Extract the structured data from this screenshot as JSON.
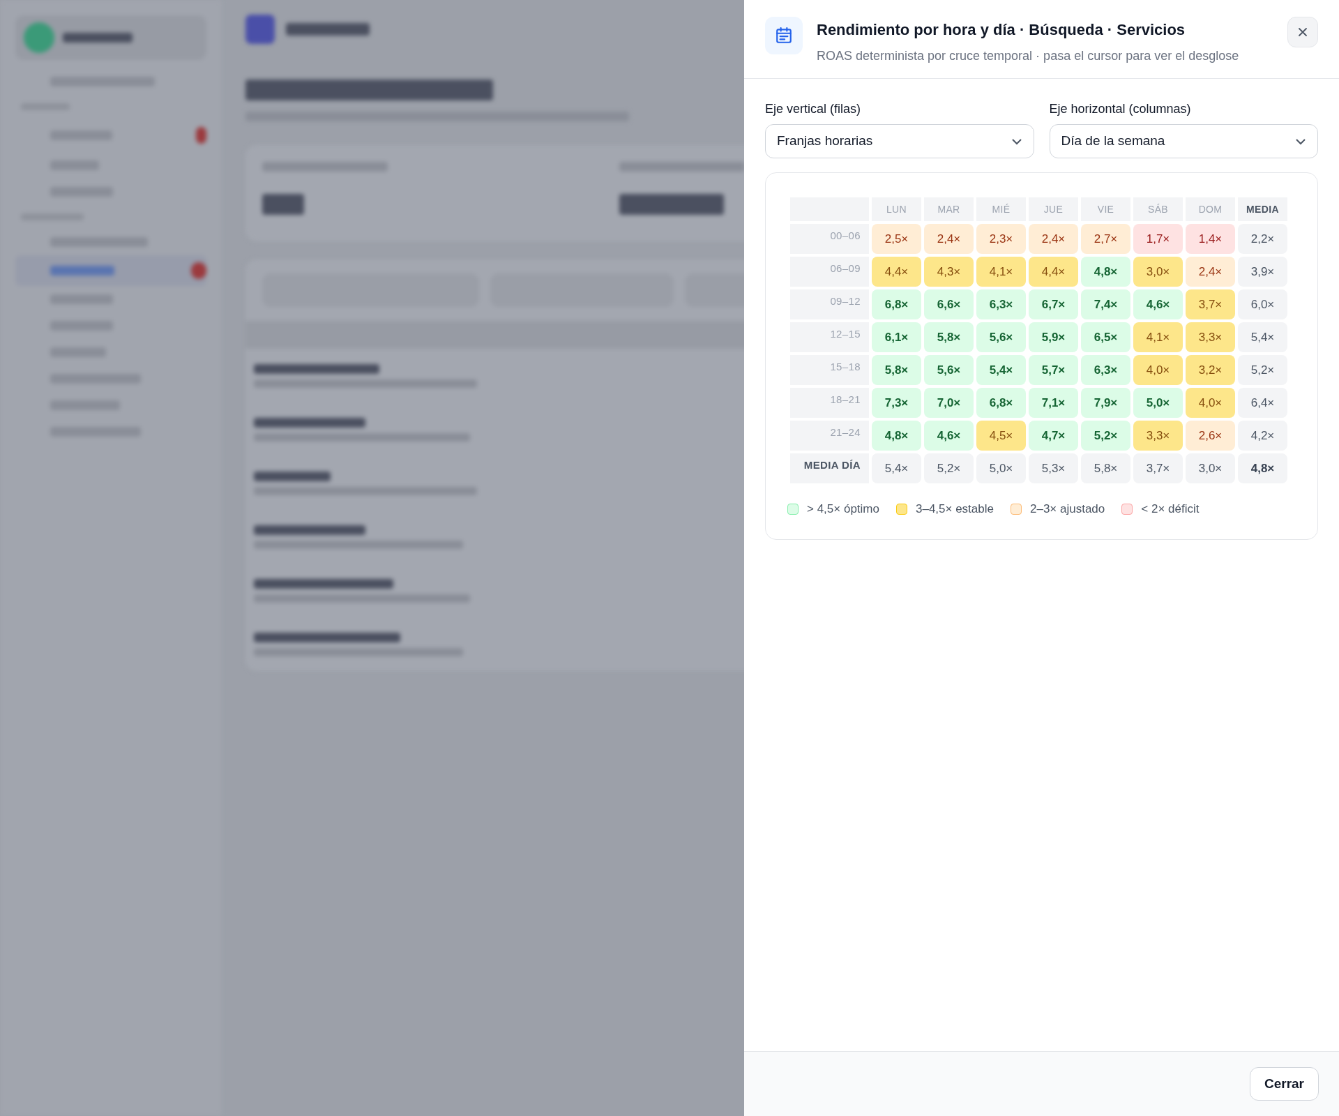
{
  "panel": {
    "title": "Rendimiento por hora y día · Búsqueda · Servicios",
    "subtitle": "ROAS determinista por cruce temporal · pasa el cursor para ver el desglose",
    "selects": [
      {
        "label": "Eje vertical (filas)",
        "value": "Franjas horarias"
      },
      {
        "label": "Eje horizontal (columnas)",
        "value": "Día de la semana"
      }
    ],
    "heatmap": {
      "columns": [
        "LUN",
        "MAR",
        "MIÉ",
        "JUE",
        "VIE",
        "SÁB",
        "DOM"
      ],
      "mean_column": "MEDIA",
      "rows": [
        {
          "label": "00–06",
          "cells": [
            {
              "value": "2,5×",
              "color": "#ffedd5"
            },
            {
              "value": "2,4×",
              "color": "#ffedd5"
            },
            {
              "value": "2,3×",
              "color": "#ffedd5"
            },
            {
              "value": "2,4×",
              "color": "#ffedd5"
            },
            {
              "value": "2,7×",
              "color": "#ffedd5"
            },
            {
              "value": "1,7×",
              "color": "#fee2e2"
            },
            {
              "value": "1,4×",
              "color": "#fee2e2"
            }
          ],
          "mean": "2,2×"
        },
        {
          "label": "06–09",
          "cells": [
            {
              "value": "4,4×",
              "color": "#fde68a"
            },
            {
              "value": "4,3×",
              "color": "#fde68a"
            },
            {
              "value": "4,1×",
              "color": "#fde68a"
            },
            {
              "value": "4,4×",
              "color": "#fde68a"
            },
            {
              "value": "4,8×",
              "color": "#dcfce7"
            },
            {
              "value": "3,0×",
              "color": "#fde68a"
            },
            {
              "value": "2,4×",
              "color": "#ffedd5"
            }
          ],
          "mean": "3,9×"
        },
        {
          "label": "09–12",
          "cells": [
            {
              "value": "6,8×",
              "color": "#dcfce7"
            },
            {
              "value": "6,6×",
              "color": "#dcfce7"
            },
            {
              "value": "6,3×",
              "color": "#dcfce7"
            },
            {
              "value": "6,7×",
              "color": "#dcfce7"
            },
            {
              "value": "7,4×",
              "color": "#dcfce7"
            },
            {
              "value": "4,6×",
              "color": "#dcfce7"
            },
            {
              "value": "3,7×",
              "color": "#fde68a"
            }
          ],
          "mean": "6,0×"
        },
        {
          "label": "12–15",
          "cells": [
            {
              "value": "6,1×",
              "color": "#dcfce7"
            },
            {
              "value": "5,8×",
              "color": "#dcfce7"
            },
            {
              "value": "5,6×",
              "color": "#dcfce7"
            },
            {
              "value": "5,9×",
              "color": "#dcfce7"
            },
            {
              "value": "6,5×",
              "color": "#dcfce7"
            },
            {
              "value": "4,1×",
              "color": "#fde68a"
            },
            {
              "value": "3,3×",
              "color": "#fde68a"
            }
          ],
          "mean": "5,4×"
        },
        {
          "label": "15–18",
          "cells": [
            {
              "value": "5,8×",
              "color": "#dcfce7"
            },
            {
              "value": "5,6×",
              "color": "#dcfce7"
            },
            {
              "value": "5,4×",
              "color": "#dcfce7"
            },
            {
              "value": "5,7×",
              "color": "#dcfce7"
            },
            {
              "value": "6,3×",
              "color": "#dcfce7"
            },
            {
              "value": "4,0×",
              "color": "#fde68a"
            },
            {
              "value": "3,2×",
              "color": "#fde68a"
            }
          ],
          "mean": "5,2×"
        },
        {
          "label": "18–21",
          "cells": [
            {
              "value": "7,3×",
              "color": "#dcfce7"
            },
            {
              "value": "7,0×",
              "color": "#dcfce7"
            },
            {
              "value": "6,8×",
              "color": "#dcfce7"
            },
            {
              "value": "7,1×",
              "color": "#dcfce7"
            },
            {
              "value": "7,9×",
              "color": "#dcfce7"
            },
            {
              "value": "5,0×",
              "color": "#dcfce7"
            },
            {
              "value": "4,0×",
              "color": "#fde68a"
            }
          ],
          "mean": "6,4×"
        },
        {
          "label": "21–24",
          "cells": [
            {
              "value": "4,8×",
              "color": "#dcfce7"
            },
            {
              "value": "4,6×",
              "color": "#dcfce7"
            },
            {
              "value": "4,5×",
              "color": "#fde68a"
            },
            {
              "value": "4,7×",
              "color": "#dcfce7"
            },
            {
              "value": "5,2×",
              "color": "#dcfce7"
            },
            {
              "value": "3,3×",
              "color": "#fde68a"
            },
            {
              "value": "2,6×",
              "color": "#ffedd5"
            }
          ],
          "mean": "4,2×"
        }
      ],
      "day_means": {
        "label": "MEDIA DÍA",
        "values": [
          "5,4×",
          "5,2×",
          "5,0×",
          "5,3×",
          "5,8×",
          "3,7×",
          "3,0×"
        ],
        "overall": "4,8×"
      }
    },
    "legend": [
      {
        "color": "#dcfce7",
        "label": "> 4,5× óptimo"
      },
      {
        "color": "#fde68a",
        "label": "3–4,5× estable"
      },
      {
        "color": "#ffedd5",
        "label": "2–3× ajustado"
      },
      {
        "color": "#fee2e2",
        "label": "< 2× déficit"
      }
    ],
    "close_button": "Cerrar"
  }
}
